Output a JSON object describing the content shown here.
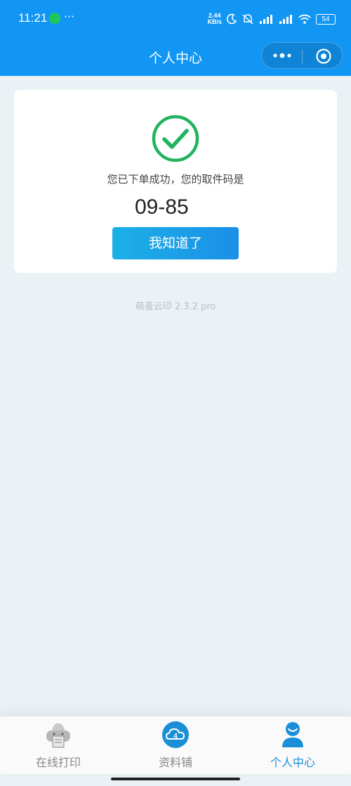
{
  "status_bar": {
    "time": "11:21",
    "dots": "···",
    "net_speed_value": "2.44",
    "net_speed_unit": "KB/s",
    "battery": "54"
  },
  "navbar": {
    "title": "个人中心"
  },
  "result": {
    "message": "您已下单成功，您的取件码是",
    "pickup_code": "09-85",
    "confirm_label": "我知道了"
  },
  "footer": {
    "version": "萌蚤云印 2.3.2 pro"
  },
  "tabbar": {
    "items": [
      {
        "label": "在线打印",
        "icon": "printer-icon",
        "active": false
      },
      {
        "label": "资料铺",
        "icon": "cloud-icon",
        "active": false
      },
      {
        "label": "个人中心",
        "icon": "user-icon",
        "active": true
      }
    ]
  },
  "colors": {
    "accent": "#1296f3",
    "success": "#22b35e",
    "active_tab": "#1a8fd8"
  }
}
